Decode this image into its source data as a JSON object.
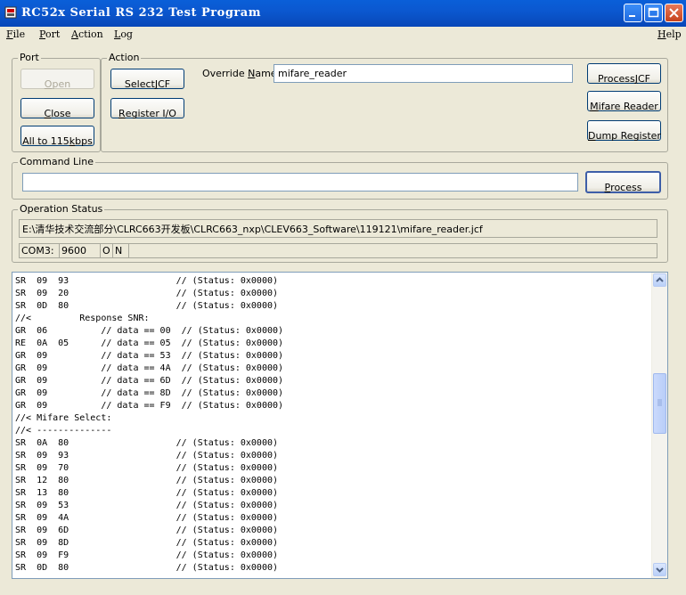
{
  "window": {
    "title": "RC52x Serial RS 232 Test Program"
  },
  "menu": {
    "file": {
      "mn": "F",
      "rest": "ile"
    },
    "port": {
      "mn": "P",
      "rest": "ort"
    },
    "action": {
      "mn": "A",
      "rest": "ction"
    },
    "log": {
      "mn": "L",
      "rest": "og"
    },
    "help": {
      "mn": "H",
      "rest": "elp"
    }
  },
  "port_group": {
    "label": "Port",
    "open": {
      "mn": "O",
      "rest": "pen"
    },
    "close": {
      "mn": "C",
      "rest": "lose"
    },
    "baud": {
      "pre": "All to 115 ",
      "mn": "k",
      "rest": "bps"
    }
  },
  "action_group": {
    "label": "Action",
    "select_jcf": {
      "pre": "Select ",
      "mn": "J",
      "rest": "CF"
    },
    "register_io": {
      "mn": "R",
      "rest": "egister I/O"
    },
    "override_label": {
      "pre": "Override ",
      "mn": "N",
      "rest": "ame:"
    },
    "override_value": "mifare_reader",
    "process_jcf": {
      "pre": "Process ",
      "mn": "J",
      "rest": "CF"
    },
    "mifare_reader": {
      "mn": "M",
      "rest": "ifare Reader"
    },
    "dump_register": {
      "mn": "D",
      "rest": "ump Register"
    }
  },
  "command_line": {
    "label": "Command Line",
    "value": "",
    "process": {
      "mn": "P",
      "rest": "rocess"
    }
  },
  "operation_status": {
    "label": "Operation Status",
    "path": "E:\\清华技术交流部分\\CLRC663开发板\\CLRC663_nxp\\CLEV663_Software\\119121\\mifare_reader.jcf",
    "port": "COM3:",
    "baud": "9600",
    "flag1": "O",
    "flag2": "N"
  },
  "log_lines": [
    "SR  09  93                    // (Status: 0x0000)",
    "SR  09  20                    // (Status: 0x0000)",
    "SR  0D  80                    // (Status: 0x0000)",
    "//<         Response SNR:",
    "GR  06          // data == 00  // (Status: 0x0000)",
    "RE  0A  05      // data == 05  // (Status: 0x0000)",
    "GR  09          // data == 53  // (Status: 0x0000)",
    "GR  09          // data == 4A  // (Status: 0x0000)",
    "GR  09          // data == 6D  // (Status: 0x0000)",
    "GR  09          // data == 8D  // (Status: 0x0000)",
    "GR  09          // data == F9  // (Status: 0x0000)",
    "//< Mifare Select:",
    "//< --------------",
    "SR  0A  80                    // (Status: 0x0000)",
    "SR  09  93                    // (Status: 0x0000)",
    "SR  09  70                    // (Status: 0x0000)",
    "SR  12  80                    // (Status: 0x0000)",
    "SR  13  80                    // (Status: 0x0000)",
    "SR  09  53                    // (Status: 0x0000)",
    "SR  09  4A                    // (Status: 0x0000)",
    "SR  09  6D                    // (Status: 0x0000)",
    "SR  09  8D                    // (Status: 0x0000)",
    "SR  09  F9                    // (Status: 0x0000)",
    "SR  0D  80                    // (Status: 0x0000)"
  ],
  "colors": {
    "titlebar": "#0a5fd8",
    "face": "#ece9d8",
    "border": "#003c74"
  },
  "icons": {
    "app": "serial-port-icon",
    "minimize": "minimize-icon",
    "maximize": "maximize-icon",
    "close": "close-icon"
  }
}
